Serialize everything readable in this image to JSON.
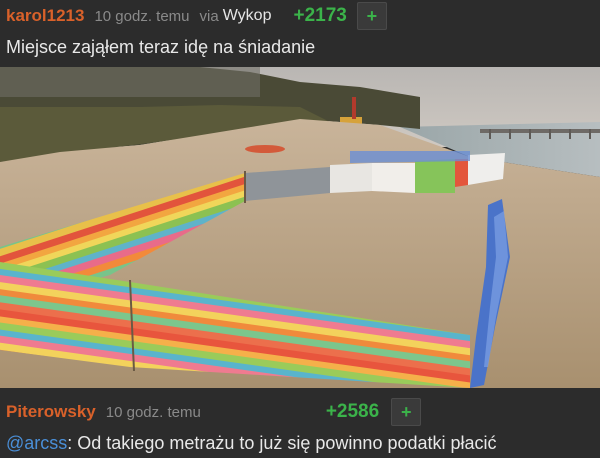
{
  "comment1": {
    "username": "karol1213",
    "username_color": "#d9612a",
    "time": "10 godz. temu",
    "via_label": "via",
    "via_source": "Wykop",
    "score": "+2173",
    "plus_label": "+",
    "body": "Miejsce zająłem teraz idę na śniadanie"
  },
  "image": {
    "icon": "beach-photo"
  },
  "comment2": {
    "username": "Piterowsky",
    "username_color": "#d9612a",
    "time": "10 godz. temu",
    "score": "+2586",
    "plus_label": "+",
    "mention": "@arcss",
    "body": ": Od takiego metrażu to już się powinno podatki płacić"
  },
  "colors": {
    "background": "#2c2c2c",
    "score_green": "#3bb34a",
    "mention_blue": "#4a8fd8"
  }
}
